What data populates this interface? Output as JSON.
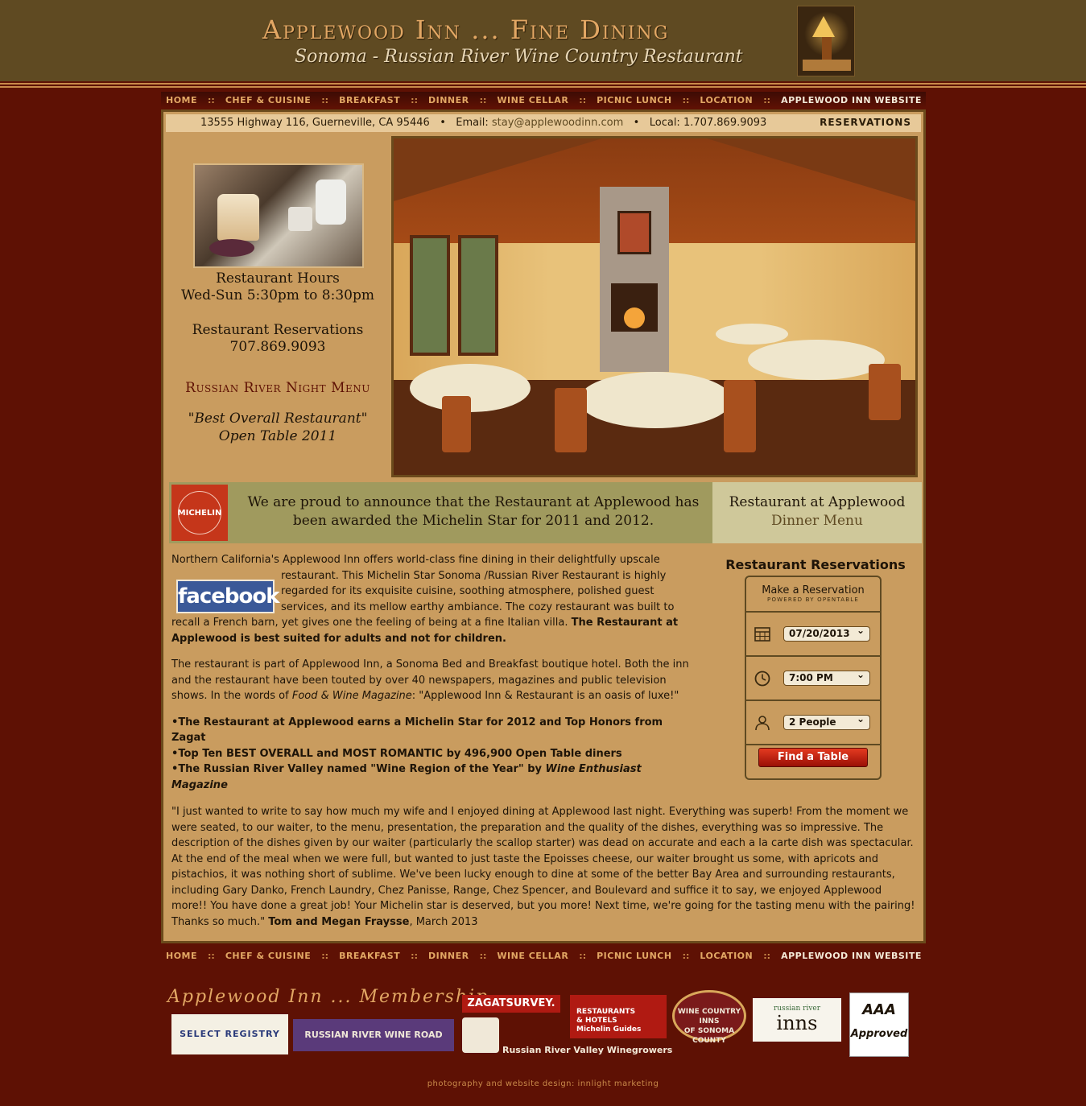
{
  "header": {
    "title": "Applewood Inn ... Fine Dining",
    "subtitle": "Sonoma - Russian River Wine Country Restaurant"
  },
  "nav": {
    "home": "HOME",
    "chef": "CHEF & CUISINE",
    "breakfast": "BREAKFAST",
    "dinner": "DINNER",
    "wine": "WINE CELLAR",
    "picnic": "PICNIC LUNCH",
    "location": "LOCATION",
    "website": "APPLEWOOD INN WEBSITE",
    "separator": "::"
  },
  "contact": {
    "address": "13555 Highway 116, Guerneville, CA 95446",
    "bullet": "•",
    "email_label": "Email:",
    "email": "stay@applewoodinn.com",
    "local": "Local: 1.707.869.9093",
    "reservations_link": "RESERVATIONS"
  },
  "sidebar": {
    "hours_title": "Restaurant Hours",
    "hours": "Wed-Sun 5:30pm to 8:30pm",
    "reservations_title": "Restaurant Reservations",
    "reservations_phone": "707.869.9093",
    "night_menu": "Russian River Night Menu",
    "award_line1": "\"Best Overall Restaurant\"",
    "award_line2": "Open Table 2011"
  },
  "michelin": {
    "logo_text": "MICHELIN",
    "announcement": "We are proud to announce that the Restaurant at Applewood has been awarded the Michelin Star for 2011 and 2012.",
    "menu_line1": "Restaurant at Applewood",
    "menu_line2": "Dinner Menu"
  },
  "content": {
    "facebook": "facebook",
    "p1": "Northern California's Applewood Inn offers world-class fine dining in their delightfully upscale restaurant. This Michelin Star Sonoma /Russian River Restaurant is highly regarded for its exquisite cuisine, soothing atmosphere, polished guest services, and its mellow earthy ambiance. The cozy restaurant was built to recall a French barn, yet gives one the feeling of being at a fine Italian villa. ",
    "p1_bold": "The Restaurant at Applewood is best suited for adults and not for children.",
    "p2_a": "The restaurant is part of Applewood Inn, a Sonoma Bed and Breakfast boutique hotel. Both the inn and the restaurant have been touted by over 40 newspapers, magazines and public television shows. In the words of ",
    "p2_mag": "Food & Wine Magazine",
    "p2_b": ": \"Applewood Inn & Restaurant is an oasis of luxe!\"",
    "bullets": [
      "The Restaurant at Applewood earns a Michelin Star for 2012 and Top Honors from Zagat",
      "Top Ten BEST OVERALL and MOST ROMANTIC by 496,900 Open Table diners",
      "The Russian River Valley named \"Wine Region of the Year\" by "
    ],
    "bullet3_mag": "Wine Enthusiast Magazine",
    "testimonial": "\"I just wanted to write to say how much my wife and I enjoyed dining at Applewood last night. Everything was superb! From the moment we were seated, to our waiter, to the menu, presentation, the preparation and the quality of the dishes, everything was so impressive. The description of the dishes given by our waiter (particularly the scallop starter) was dead on accurate and each a la carte dish was spectacular. At the end of the meal when we were full, but wanted to just taste the Epoisses cheese, our waiter brought us some, with apricots and pistachios, it was nothing short of sublime. We've been lucky enough to dine at some of the better Bay Area and surrounding restaurants, including Gary Danko, French Laundry, Chez Panisse, Range, Chez Spencer, and Boulevard and suffice it to say, we enjoyed Applewood more!! You have done a great job! Your Michelin star is deserved, but you more! Next time, we're going for the tasting menu with the pairing! Thanks so much.\" ",
    "testimonial_author": "Tom and Megan Fraysse",
    "testimonial_date": ", March 2013"
  },
  "reservation": {
    "title": "Restaurant Reservations",
    "widget_title": "Make a Reservation",
    "powered_by": "POWERED BY OPENTABLE",
    "date": "07/20/2013",
    "time": "7:00 PM",
    "party": "2 People",
    "button": "Find a Table"
  },
  "membership": {
    "title": "Applewood Inn ... Membership",
    "select_registry": "SELECT REGISTRY",
    "rrwr": "RUSSIAN RIVER WINE ROAD",
    "zagat": "ZAGATSURVEY.",
    "rrvw": "Russian River Valley Winegrowers",
    "rh_line1": "RESTAURANTS",
    "rh_line2": "& HOTELS",
    "rh_line3": "Michelin Guides",
    "wcsc_line1": "WINE COUNTRY",
    "wcsc_line2": "INNS",
    "wcsc_line3": "OF SONOMA COUNTY",
    "rri_small": "russian river",
    "rri_big": "inns",
    "aaa_line1": "AAA",
    "aaa_line2": "Approved"
  },
  "footer": {
    "credit": "photography and website design: innlight marketing"
  },
  "colors": {
    "background": "#5e1104",
    "header": "#5f4a22",
    "accent": "#e2a764",
    "panel": "#c99c5f"
  }
}
